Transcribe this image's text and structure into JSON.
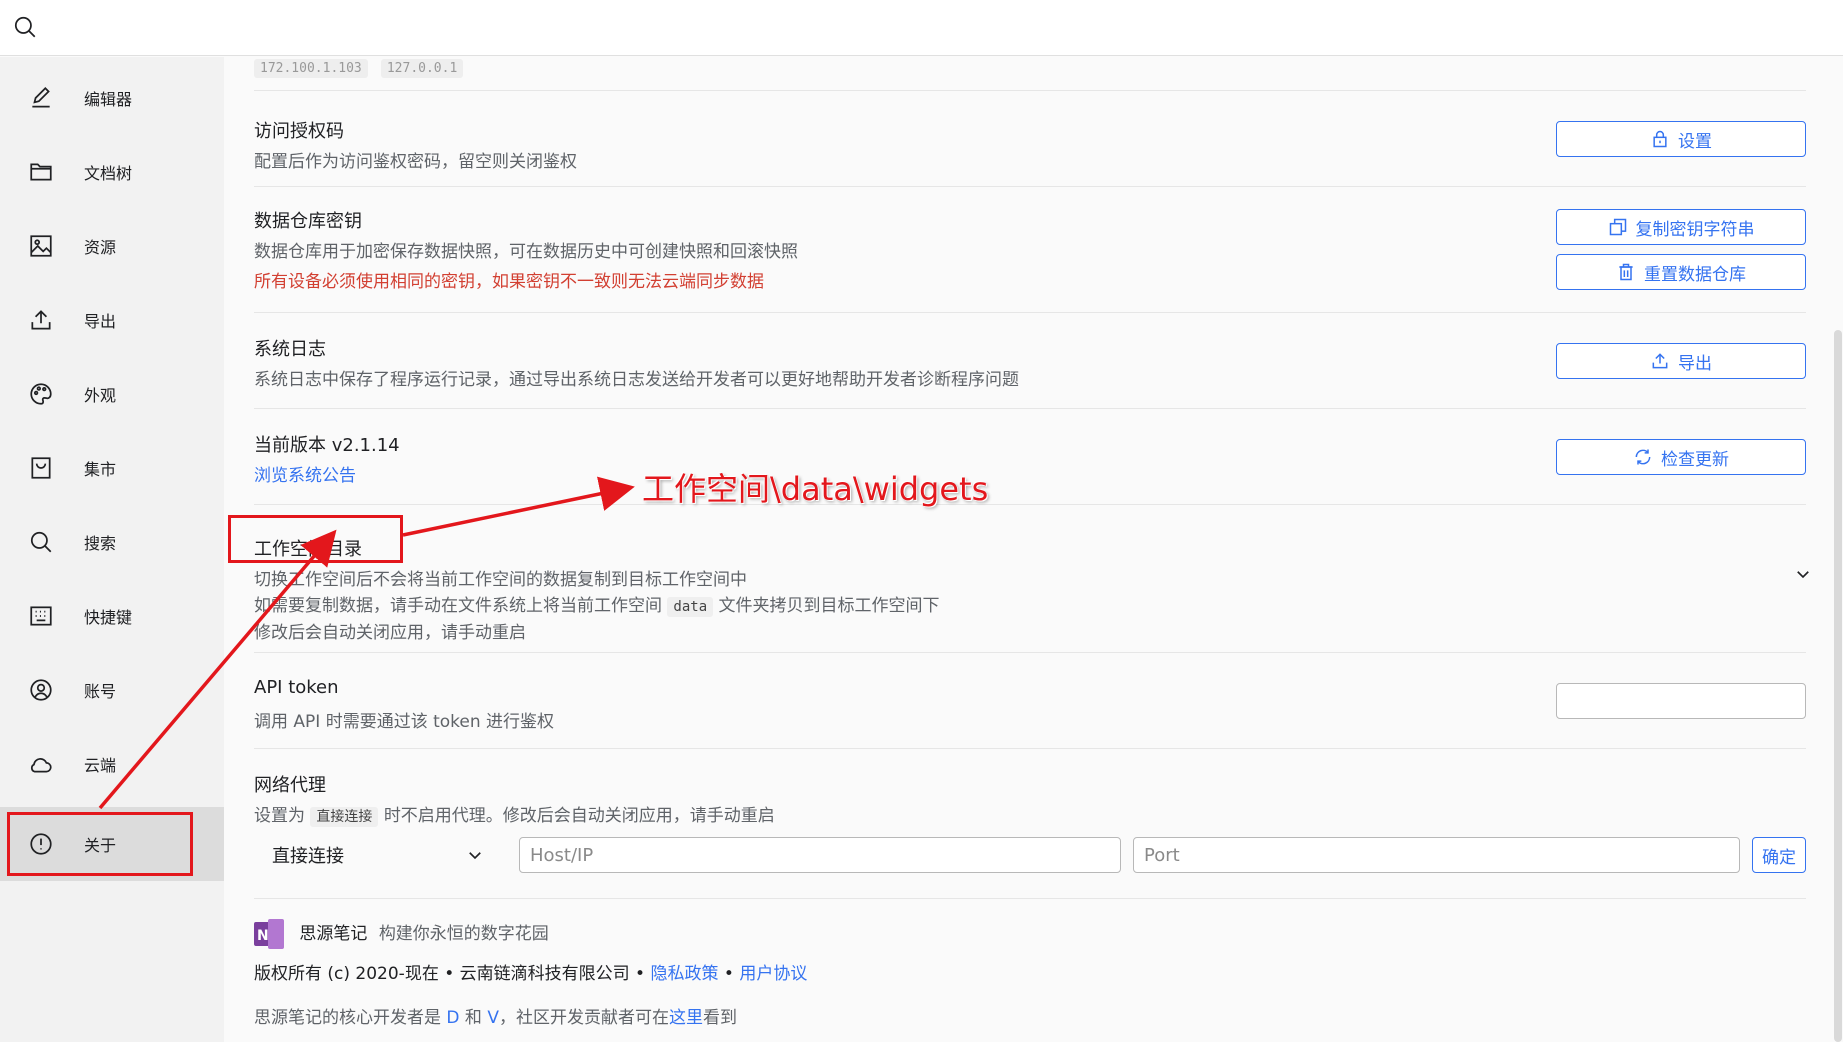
{
  "search": {
    "placeholder": ""
  },
  "sidebar": {
    "items": [
      {
        "label": "编辑器",
        "icon": "pencil-icon"
      },
      {
        "label": "文档树",
        "icon": "folder-icon"
      },
      {
        "label": "资源",
        "icon": "image-icon"
      },
      {
        "label": "导出",
        "icon": "upload-icon"
      },
      {
        "label": "外观",
        "icon": "palette-icon"
      },
      {
        "label": "集市",
        "icon": "bazaar-icon"
      },
      {
        "label": "搜索",
        "icon": "search-icon"
      },
      {
        "label": "快捷键",
        "icon": "keyboard-icon"
      },
      {
        "label": "账号",
        "icon": "account-icon"
      },
      {
        "label": "云端",
        "icon": "cloud-icon"
      },
      {
        "label": "关于",
        "icon": "info-icon",
        "active": true
      }
    ]
  },
  "network_addresses": [
    "172.100.1.103",
    "127.0.0.1"
  ],
  "auth_code": {
    "title": "访问授权码",
    "desc": "配置后作为访问鉴权密码，留空则关闭鉴权",
    "button": "设置"
  },
  "repo_key": {
    "title": "数据仓库密钥",
    "desc": "数据仓库用于加密保存数据快照，可在数据历史中可创建快照和回滚快照",
    "warning": "所有设备必须使用相同的密钥，如果密钥不一致则无法云端同步数据",
    "copy_button": "复制密钥字符串",
    "reset_button": "重置数据仓库"
  },
  "system_log": {
    "title": "系统日志",
    "desc": "系统日志中保存了程序运行记录，通过导出系统日志发送给开发者可以更好地帮助开发者诊断程序问题",
    "button": "导出"
  },
  "version": {
    "title": "当前版本 v2.1.14",
    "link": "浏览系统公告",
    "button": "检查更新"
  },
  "workspace": {
    "title": "工作空间目录",
    "desc1": "切换工作空间后不会将当前工作空间的数据复制到目标工作空间中",
    "desc2_before": "如需要复制数据，请手动在文件系统上将当前工作空间",
    "desc2_code": "data",
    "desc2_after": "文件夹拷贝到目标工作空间下",
    "desc3": "修改后会自动关闭应用，请手动重启"
  },
  "api_token": {
    "title": "API token",
    "desc": "调用 API 时需要通过该 token 进行鉴权",
    "value": ""
  },
  "proxy": {
    "title": "网络代理",
    "desc_before": "设置为",
    "desc_code": "直接连接",
    "desc_after": "时不启用代理。修改后会自动关闭应用，请手动重启",
    "selected": "直接连接",
    "host_placeholder": "Host/IP",
    "port_placeholder": "Port",
    "confirm": "确定"
  },
  "footer": {
    "app_name": "思源笔记",
    "slogan": "构建你永恒的数字花园",
    "copyright": "版权所有 (c) 2020-现在 • 云南链滴科技有限公司 •",
    "privacy": "隐私政策",
    "sep": "•",
    "agreement": "用户协议",
    "devs_before": "思源笔记的核心开发者是",
    "dev_d": "D",
    "and": "和",
    "dev_v": "V",
    "devs_mid": "，社区开发贡献者可在",
    "here": "这里",
    "devs_after": "看到"
  },
  "annotation": {
    "text": "工作空间\\data\\widgets",
    "color": "#e3171c"
  },
  "colors": {
    "accent": "#3573f0",
    "warning": "#d23f31",
    "annotation": "#e3171c"
  }
}
